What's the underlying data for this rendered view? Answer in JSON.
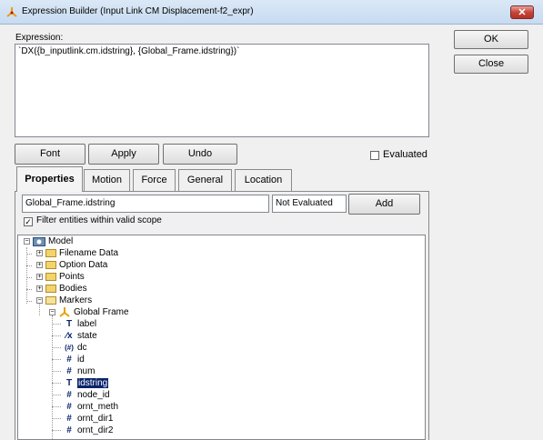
{
  "window": {
    "title": "Expression Builder (Input Link CM Displacement-f2_expr)",
    "close_glyph": "✕"
  },
  "expression": {
    "label": "Expression:",
    "value": "`DX({b_inputlink.cm.idstring}, {Global_Frame.idstring})`"
  },
  "side_buttons": {
    "ok": "OK",
    "close": "Close"
  },
  "toolbar": {
    "font": "Font",
    "apply": "Apply",
    "undo": "Undo",
    "evaluated": "Evaluated"
  },
  "tabs": [
    "Properties",
    "Motion",
    "Force",
    "General",
    "Location"
  ],
  "properties": {
    "selected_value": "Global_Frame.idstring",
    "status": "Not Evaluated",
    "add": "Add",
    "filter_label": "Filter entities within valid scope",
    "filter_checked": "✓"
  },
  "tree": {
    "model": "Model",
    "folders": [
      "Filename Data",
      "Option Data",
      "Points",
      "Bodies",
      "Markers"
    ],
    "global_frame": "Global Frame",
    "attributes": [
      {
        "icon": "T",
        "label": "label"
      },
      {
        "icon": "⁄x",
        "label": "state"
      },
      {
        "icon": "(#)",
        "label": "dc"
      },
      {
        "icon": "#",
        "label": "id"
      },
      {
        "icon": "#",
        "label": "num"
      },
      {
        "icon": "T",
        "label": "idstring"
      },
      {
        "icon": "#",
        "label": "node_id"
      },
      {
        "icon": "#",
        "label": "ornt_meth"
      },
      {
        "icon": "#",
        "label": "ornt_dir1"
      },
      {
        "icon": "#",
        "label": "ornt_dir2"
      }
    ],
    "selected": "idstring"
  },
  "colors": {
    "selection": "#0a246a",
    "titlebar": "#c7dbf1",
    "close_button": "#c5453a"
  }
}
